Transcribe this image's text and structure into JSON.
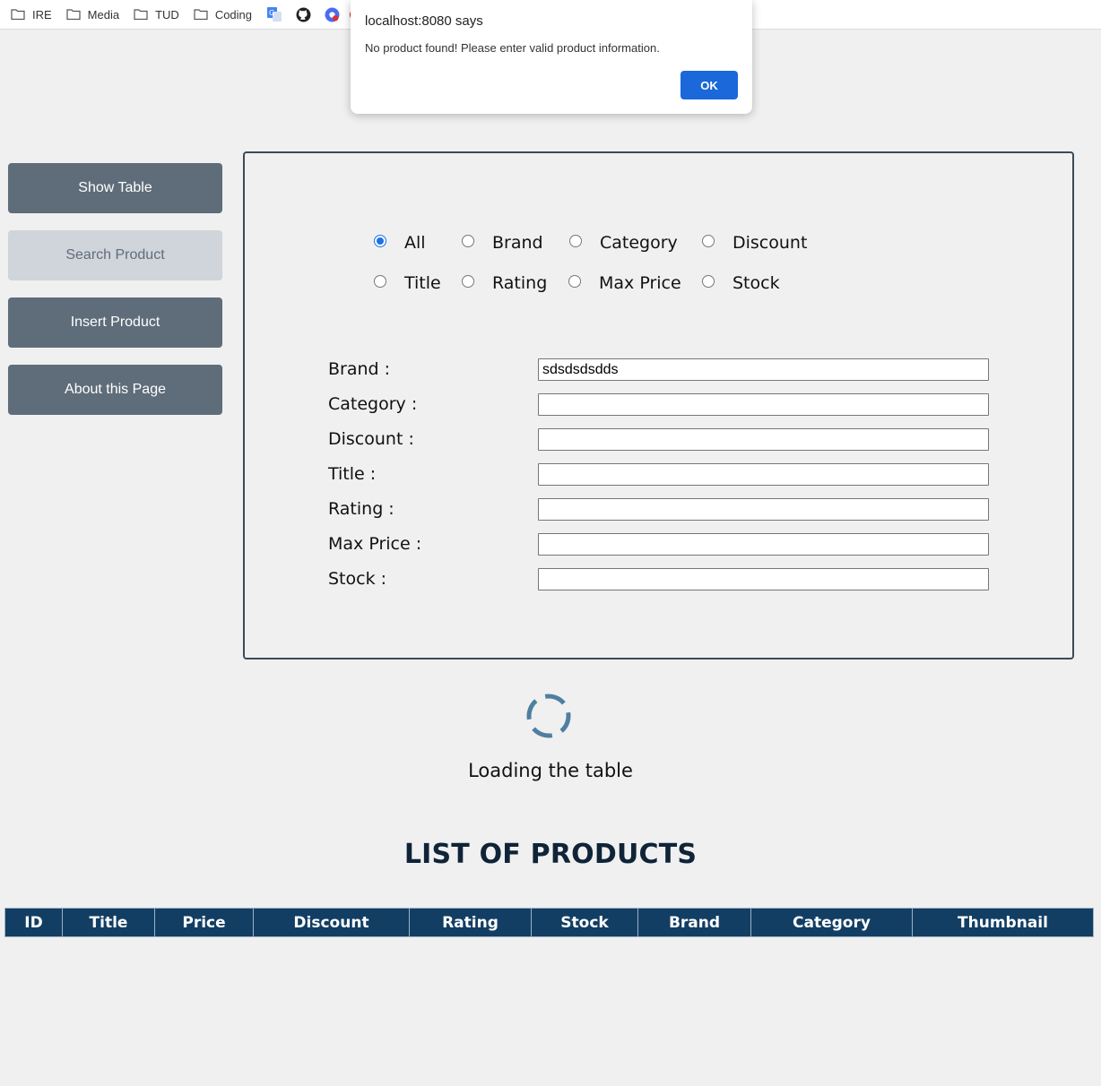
{
  "bookmarks": {
    "folders": [
      "IRE",
      "Media",
      "TUD",
      "Coding"
    ],
    "icons": [
      "google-translate-icon",
      "github-icon",
      "chrome-extension-icon",
      "youtube-icon"
    ]
  },
  "sidebar": {
    "items": [
      {
        "label": "Show Table"
      },
      {
        "label": "Search Product"
      },
      {
        "label": "Insert Product"
      },
      {
        "label": "About this Page"
      }
    ]
  },
  "search": {
    "radios": [
      {
        "label": "All",
        "checked": true
      },
      {
        "label": "Brand"
      },
      {
        "label": "Category"
      },
      {
        "label": "Discount"
      },
      {
        "label": "Title"
      },
      {
        "label": "Rating"
      },
      {
        "label": "Max Price"
      },
      {
        "label": "Stock"
      }
    ],
    "fields": [
      {
        "label": "Brand :",
        "value": "sdsdsdsdds"
      },
      {
        "label": "Category :",
        "value": ""
      },
      {
        "label": "Discount :",
        "value": ""
      },
      {
        "label": "Title :",
        "value": ""
      },
      {
        "label": "Rating :",
        "value": ""
      },
      {
        "label": "Max Price :",
        "value": ""
      },
      {
        "label": "Stock :",
        "value": ""
      }
    ]
  },
  "loading": {
    "text": "Loading the table"
  },
  "products": {
    "title": "LIST OF PRODUCTS",
    "columns": [
      "ID",
      "Title",
      "Price",
      "Discount",
      "Rating",
      "Stock",
      "Brand",
      "Category",
      "Thumbnail"
    ]
  },
  "dialog": {
    "title": "localhost:8080 says",
    "message": "No product found! Please enter valid product information.",
    "ok_label": "OK"
  },
  "colors": {
    "sidebar_button": "#5f6d7a",
    "sidebar_active": "#d0d4db",
    "table_header": "#123e63",
    "accent": "#1a68d9"
  }
}
